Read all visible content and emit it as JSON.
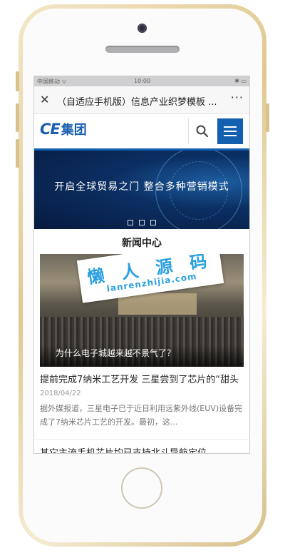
{
  "status_bar": {
    "carrier": "中国移动 ᯤ",
    "time": "10:00",
    "right": "✱ ▭"
  },
  "browser": {
    "close_glyph": "✕",
    "title": "（自适应手机版）信息产业织梦模板 ...",
    "more_glyph": "···"
  },
  "header": {
    "logo_en": "CE",
    "logo_cn": "集团",
    "search_icon": "search-icon",
    "menu_icon": "menu-icon"
  },
  "banner": {
    "text": "开启全球贸易之门 整合多种营销模式"
  },
  "news": {
    "section_title": "新闻中心",
    "featured_caption": "为什么电子城越来越不景气了？",
    "watermark_cn": "懒 人 源 码",
    "watermark_en": "lanrenzhijia.com",
    "article1": {
      "title": "提前完成7纳米工艺开发 三星尝到了芯片的“甜头",
      "date": "2018/04/22",
      "summary": "据外媒报道，三星电子已于近日利用远紫外线(EUV)设备完成了7纳米芯片工艺的开发。最初，这..."
    },
    "article2": {
      "title": "其它主流手机芯片均已支持北斗导航定位"
    }
  },
  "colors": {
    "brand_blue": "#1460b0",
    "phone_gold": "#e0c890"
  }
}
